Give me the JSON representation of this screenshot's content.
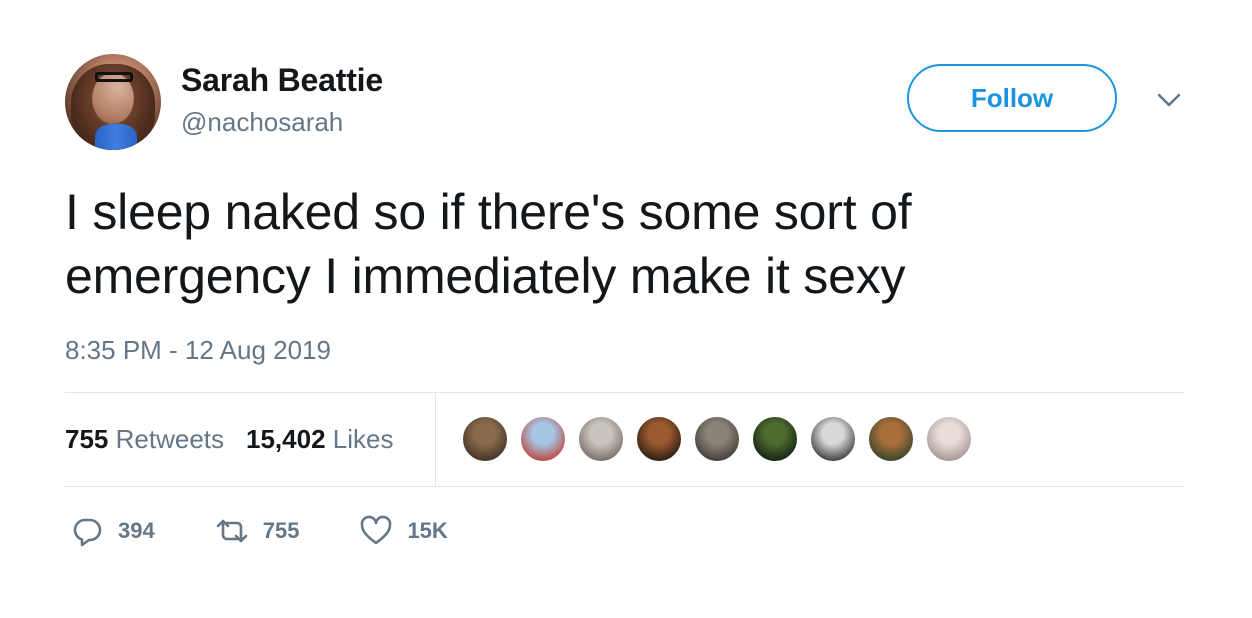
{
  "author": {
    "name": "Sarah Beattie",
    "handle": "@nachosarah",
    "follow_label": "Follow"
  },
  "tweet": {
    "line1": "I sleep naked so if there's some sort of",
    "line2": "emergency I immediately make it sexy",
    "timestamp": "8:35 PM - 12 Aug 2019"
  },
  "stats": {
    "retweets_count": "755",
    "retweets_label": "Retweets",
    "likes_count": "15,402",
    "likes_label": "Likes"
  },
  "likers": [
    {
      "color1": "#8a6a4c",
      "color2": "#3c2c22"
    },
    {
      "color1": "#a7c6e6",
      "color2": "#c0392b"
    },
    {
      "color1": "#c9c4bd",
      "color2": "#6e655c"
    },
    {
      "color1": "#9b5a2f",
      "color2": "#1d1410"
    },
    {
      "color1": "#8b8378",
      "color2": "#3a3530"
    },
    {
      "color1": "#4c6b2e",
      "color2": "#101812"
    },
    {
      "color1": "#d8d8d8",
      "color2": "#2b2b2b"
    },
    {
      "color1": "#a86f3b",
      "color2": "#2b3f2b"
    },
    {
      "color1": "#e7dcd8",
      "color2": "#9a8f8c"
    }
  ],
  "actions": {
    "replies": "394",
    "retweets": "755",
    "likes": "15K"
  },
  "colors": {
    "accent": "#1b95e0",
    "secondary_text": "#657786",
    "primary_text": "#14171a",
    "divider": "#e1e8ed"
  }
}
